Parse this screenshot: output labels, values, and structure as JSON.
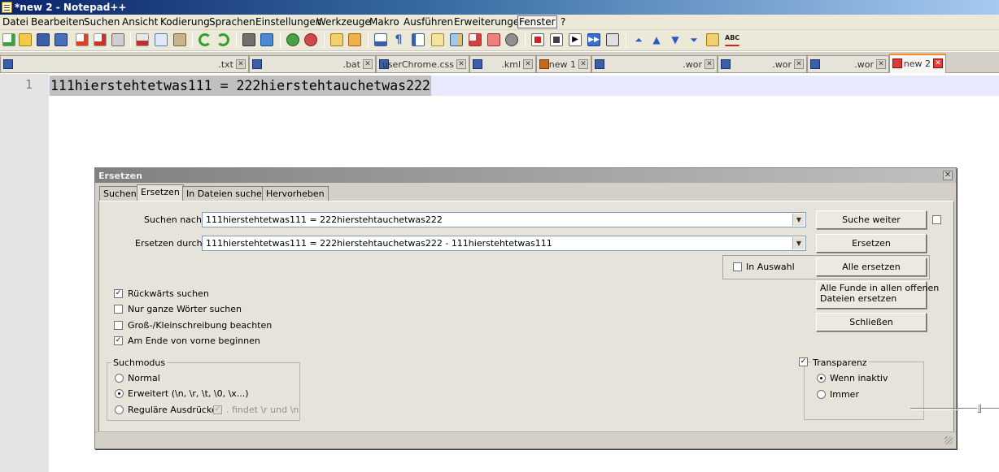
{
  "window": {
    "title": "*new 2 - Notepad++"
  },
  "menu": [
    "Datei",
    "Bearbeiten",
    "Suchen",
    "Ansicht",
    "Kodierung",
    "Sprachen",
    "Einstellungen",
    "Werkzeuge",
    "Makro",
    "Ausführen",
    "Erweiterungen",
    "Fenster",
    "?"
  ],
  "toolbar_icons": [
    "new-file-icon",
    "open-file-icon",
    "save-icon",
    "save-all-icon",
    "close-icon",
    "close-all-icon",
    "print-icon",
    "cut-icon",
    "copy-icon",
    "paste-icon",
    "undo-icon",
    "redo-icon",
    "find-icon",
    "replace-icon",
    "zoom-in-icon",
    "zoom-out-icon",
    "sync-v-icon",
    "sync-h-icon",
    "wrap-icon",
    "all-chars-icon",
    "indent-guide-icon",
    "udl-icon",
    "doc-map-icon",
    "function-list-icon",
    "folder-icon",
    "monitor-icon",
    "record-macro-icon",
    "stop-macro-icon",
    "play-macro-icon",
    "run-macro-multiple-icon",
    "save-macro-icon",
    "trim-icon",
    "up-icon",
    "down-icon",
    "sort-icon",
    "print-preview-icon",
    "spellcheck-icon"
  ],
  "tabs": [
    {
      "label": ".txt"
    },
    {
      "label": ".bat"
    },
    {
      "label": "userChrome.css"
    },
    {
      "label": ".kml"
    },
    {
      "label": "new 1"
    },
    {
      "label": ".wor"
    },
    {
      "label": ".wor"
    },
    {
      "label": ".wor"
    },
    {
      "label": "new 2"
    }
  ],
  "editor": {
    "line_number": "1",
    "line_text": "111hierstehtetwas111 = 222hierstehtauchetwas222"
  },
  "dialog": {
    "title": "Ersetzen",
    "tabs": [
      "Suchen",
      "Ersetzen",
      "In Dateien suchen",
      "Hervorheben"
    ],
    "find_label": "Suchen nach:",
    "find_value": "111hierstehtetwas111 = 222hierstehtauchetwas222",
    "replace_label": "Ersetzen durch:",
    "replace_value": "111hierstehtetwas111 = 222hierstehtauchetwas222 - 111hierstehtetwas111",
    "buttons": {
      "find_next": "Suche weiter",
      "replace": "Ersetzen",
      "replace_all": "Alle ersetzen",
      "replace_all_open_line1": "Alle Funde in allen offenen",
      "replace_all_open_line2": "Dateien ersetzen",
      "close": "Schließen"
    },
    "in_selection": "In Auswahl",
    "options": {
      "backward": "Rückwärts suchen",
      "whole_word": "Nur ganze Wörter suchen",
      "match_case": "Groß-/Kleinschreibung beachten",
      "wrap_around": "Am Ende von vorne beginnen"
    },
    "search_mode": {
      "legend": "Suchmodus",
      "normal": "Normal",
      "extended": "Erweitert (\\n, \\r, \\t, \\0, \\x...)",
      "regex": "Reguläre Ausdrücke",
      "dot_matches": ". findet \\r und \\n"
    },
    "transparency": {
      "legend": "Transparenz",
      "on_lose_focus": "Wenn inaktiv",
      "always": "Immer"
    }
  }
}
